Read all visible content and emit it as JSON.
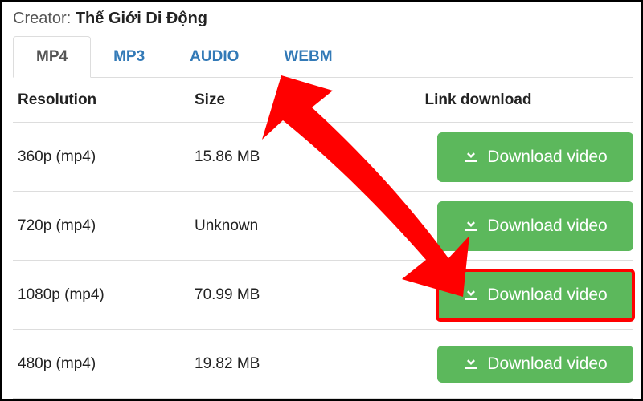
{
  "creator": {
    "label": "Creator: ",
    "name": "Thế Giới Di Động"
  },
  "tabs": [
    {
      "label": "MP4",
      "active": true
    },
    {
      "label": "MP3",
      "active": false
    },
    {
      "label": "AUDIO",
      "active": false
    },
    {
      "label": "WEBM",
      "active": false
    }
  ],
  "table": {
    "headers": {
      "resolution": "Resolution",
      "size": "Size",
      "link": "Link download"
    },
    "button_label": "Download video",
    "rows": [
      {
        "resolution": "360p (mp4)",
        "size": "15.86 MB",
        "highlighted": false
      },
      {
        "resolution": "720p (mp4)",
        "size": "Unknown",
        "highlighted": false
      },
      {
        "resolution": "1080p (mp4)",
        "size": "70.99 MB",
        "highlighted": true
      },
      {
        "resolution": "480p (mp4)",
        "size": "19.82 MB",
        "highlighted": false
      }
    ]
  },
  "colors": {
    "accent_button": "#5cb85c",
    "tab_link": "#337ab7",
    "highlight_box": "#ff0000",
    "annotation_arrow": "#ff0000"
  }
}
